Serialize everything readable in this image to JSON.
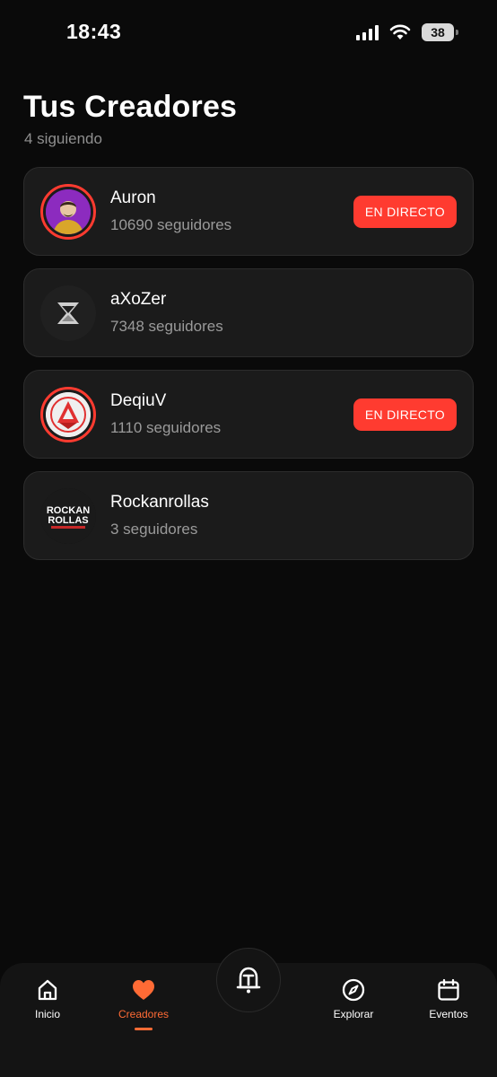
{
  "status_bar": {
    "time": "18:43",
    "battery": "38"
  },
  "header": {
    "title": "Tus Creadores",
    "subtitle": "4 siguiendo"
  },
  "creators": [
    {
      "name": "Auron",
      "followers": "10690 seguidores",
      "live": true,
      "live_label": "EN DIRECTO"
    },
    {
      "name": "aXoZer",
      "followers": "7348 seguidores",
      "live": false
    },
    {
      "name": "DeqiuV",
      "followers": "1110 seguidores",
      "live": true,
      "live_label": "EN DIRECTO"
    },
    {
      "name": "Rockanrollas",
      "followers": "3 seguidores",
      "live": false,
      "avatar_text": [
        "ROCKAN",
        "ROLLAS"
      ]
    }
  ],
  "tabs": {
    "home": "Inicio",
    "creators": "Creadores",
    "explore": "Explorar",
    "events": "Eventos"
  },
  "colors": {
    "live": "#ff3b30",
    "accent": "#ff6b35",
    "card_bg": "#1b1b1b",
    "background": "#0a0a0a"
  }
}
